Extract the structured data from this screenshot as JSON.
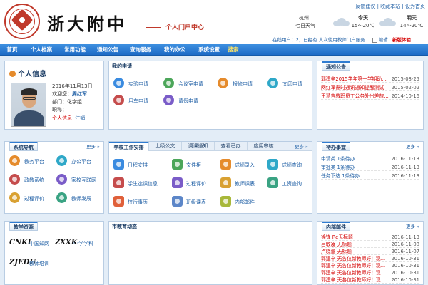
{
  "header": {
    "site_name": "浙大附中",
    "portal_title": "个人门户中心",
    "top_links": "反馈建议 | 收藏本站 | 设为首页",
    "weather": {
      "city": "杭州",
      "city_weather": "七日天气",
      "today_label": "今天",
      "today_temp": "15～20℃",
      "tomorrow_label": "明天",
      "tomorrow_temp": "14～20℃"
    },
    "online_text": "在线用户：2，已经有 人次使用教师门户服务",
    "edit_label": "编辑",
    "new_label": "新版体验"
  },
  "nav": [
    "首页",
    "个人档案",
    "常用功能",
    "通知公告",
    "查询服务",
    "我的办公",
    "系统设置",
    "搜索"
  ],
  "profile": {
    "title": "个人信息",
    "date": "2016年11月13日",
    "welcome_label": "欢迎您：",
    "name": "周红军",
    "dept": "部门：化学组",
    "title_label": "职称：",
    "info_link": "个人信息",
    "logout_link": "注销"
  },
  "my_apply": {
    "title": "我的申请",
    "items": [
      "实验申请",
      "会议室申请",
      "报修申请",
      "文印申请",
      "用车申请",
      "请假申请"
    ]
  },
  "notice": {
    "title": "通知公告",
    "more": "更多",
    "rows": [
      {
        "t": "郭建辛2015学年第一学期助...",
        "d": "2015-08-25",
        "c": "#d40000"
      },
      {
        "t": "网红军需时通讯通知提醒测试",
        "d": "2015-02-02",
        "c": "#d40000"
      },
      {
        "t": "王慧吉教职员工公务外出差旅...",
        "d": "2014-10-16",
        "c": "#d40000"
      }
    ]
  },
  "system_nav": {
    "title": "系统导航",
    "more": "更多",
    "items": [
      "教务平台",
      "办公平台",
      "政教系统",
      "家校互联网",
      "过程评价",
      "教师发展"
    ]
  },
  "work": {
    "tabs": [
      "学校工作安排",
      "上级公文",
      "调课通知",
      "查看已办",
      "应用审核"
    ],
    "more": "更多",
    "items": [
      "日程安排",
      "文件柜",
      "成绩录入",
      "成绩查询",
      "学生选课信息",
      "过程评价",
      "教师课表",
      "工资查询",
      "校行事历",
      "班级课表",
      "内部邮件"
    ]
  },
  "todo": {
    "title": "待办事宜",
    "more": "更多",
    "rows": [
      {
        "t": "申请类 1条待办",
        "d": "2016-11-13"
      },
      {
        "t": "审批类 1条待办",
        "d": "2016-11-13"
      },
      {
        "t": "任务下达 1条待办",
        "d": "2016-11-13"
      }
    ]
  },
  "teaching": {
    "title": "教学资源",
    "items": [
      {
        "logo": "CNKI",
        "label": "中国知网"
      },
      {
        "logo": "ZXXK",
        "label": "中学学科"
      },
      {
        "logo": "ZJEDU",
        "label": "教师培训"
      }
    ]
  },
  "edu_news": {
    "title": "市教育动态"
  },
  "mail": {
    "title": "内部邮件",
    "more": "更多",
    "rows": [
      {
        "t": "徐锋 Re无标题",
        "d": "2016-11-13",
        "c": "#d40000"
      },
      {
        "t": "吕敏凌 无标题",
        "d": "2016-11-08",
        "c": "#d40000"
      },
      {
        "t": "卢晓蕾 无标题",
        "d": "2016-11-07",
        "c": "#d40000"
      },
      {
        "t": "郭建辛 无各位新教师好！现...",
        "d": "2016-10-31",
        "c": "#d40000"
      },
      {
        "t": "郭建辛 无各位新教师好！现...",
        "d": "2016-10-31",
        "c": "#d40000"
      },
      {
        "t": "郭建辛 无各位新教师好！现...",
        "d": "2016-10-31",
        "c": "#d40000"
      },
      {
        "t": "郭建辛 无各位新教师好！现...",
        "d": "2016-10-31",
        "c": "#d40000"
      }
    ]
  }
}
